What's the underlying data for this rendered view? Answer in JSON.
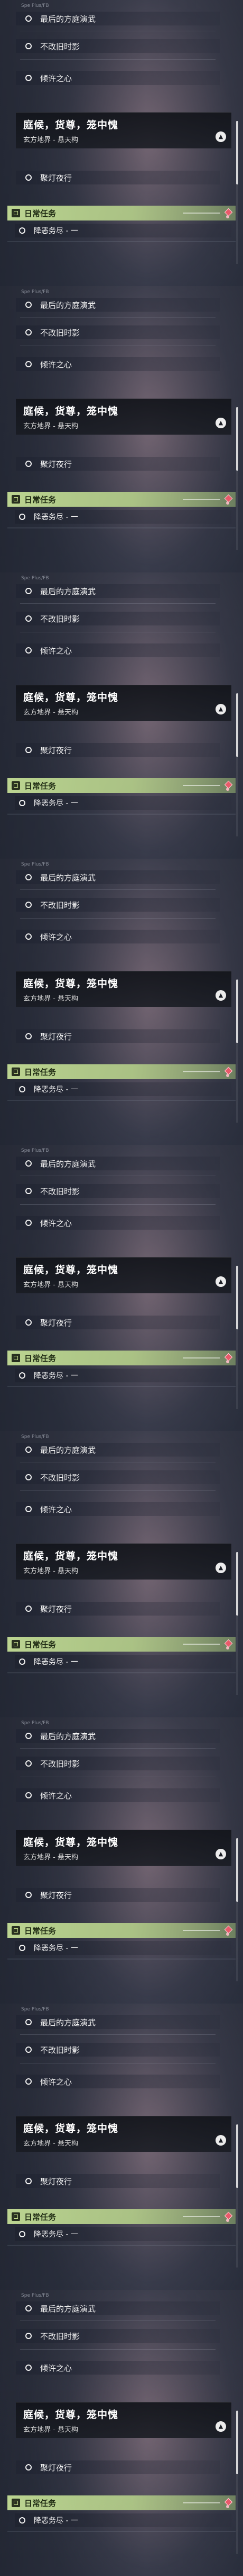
{
  "header": {
    "caption": "Spe Plus/FB"
  },
  "quests": [
    {
      "label": "最后的方庭演武"
    },
    {
      "label": "不改旧时影"
    },
    {
      "label": "倾许之心"
    }
  ],
  "main_quest": {
    "title": "庭候，货尊，笼中愧",
    "subtitle": "玄方地界 - 悬天构",
    "collapse_icon": "chevron-up-icon"
  },
  "sub_quest": {
    "label": "聚灯夜行"
  },
  "daily": {
    "header": "日常任务",
    "item": "降恶务尽 - 一",
    "accent": "#c4de96",
    "gem_color": "#e85a6a"
  },
  "repeat_count": 9
}
